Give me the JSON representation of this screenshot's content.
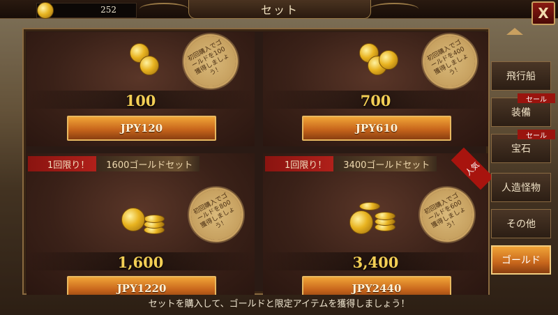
{
  "header": {
    "title": "セット",
    "currency": "252",
    "close_label": "X"
  },
  "cards": [
    {
      "amount": "100",
      "price": "JPY120",
      "seal_text": "初回購入でゴールドを100獲得しましょう！"
    },
    {
      "amount": "700",
      "price": "JPY610",
      "seal_text": "初回購入でゴールドを400獲得しましょう！"
    },
    {
      "banner_left": "1回限り！",
      "banner_right": "1600ゴールドセット",
      "amount": "1,600",
      "price": "JPY1220",
      "seal_text": "初回購入でゴールドを800獲得しましょう！"
    },
    {
      "banner_left": "1回限り！",
      "banner_right": "3400ゴールドセット",
      "badge": "人気",
      "amount": "3,400",
      "price": "JPY2440",
      "seal_text": "初回購入でゴールドを600獲得しましょう！"
    }
  ],
  "sidebar": {
    "items": [
      {
        "label": "飛行船"
      },
      {
        "label": "装備",
        "tag": "セール"
      },
      {
        "label": "宝石",
        "tag": "セール"
      },
      {
        "label": "人造怪物"
      },
      {
        "label": "その他"
      },
      {
        "label": "ゴールド",
        "active": true
      }
    ]
  },
  "footer": {
    "text": "セットを購入して、ゴールドと限定アイテムを獲得しましょう！"
  }
}
